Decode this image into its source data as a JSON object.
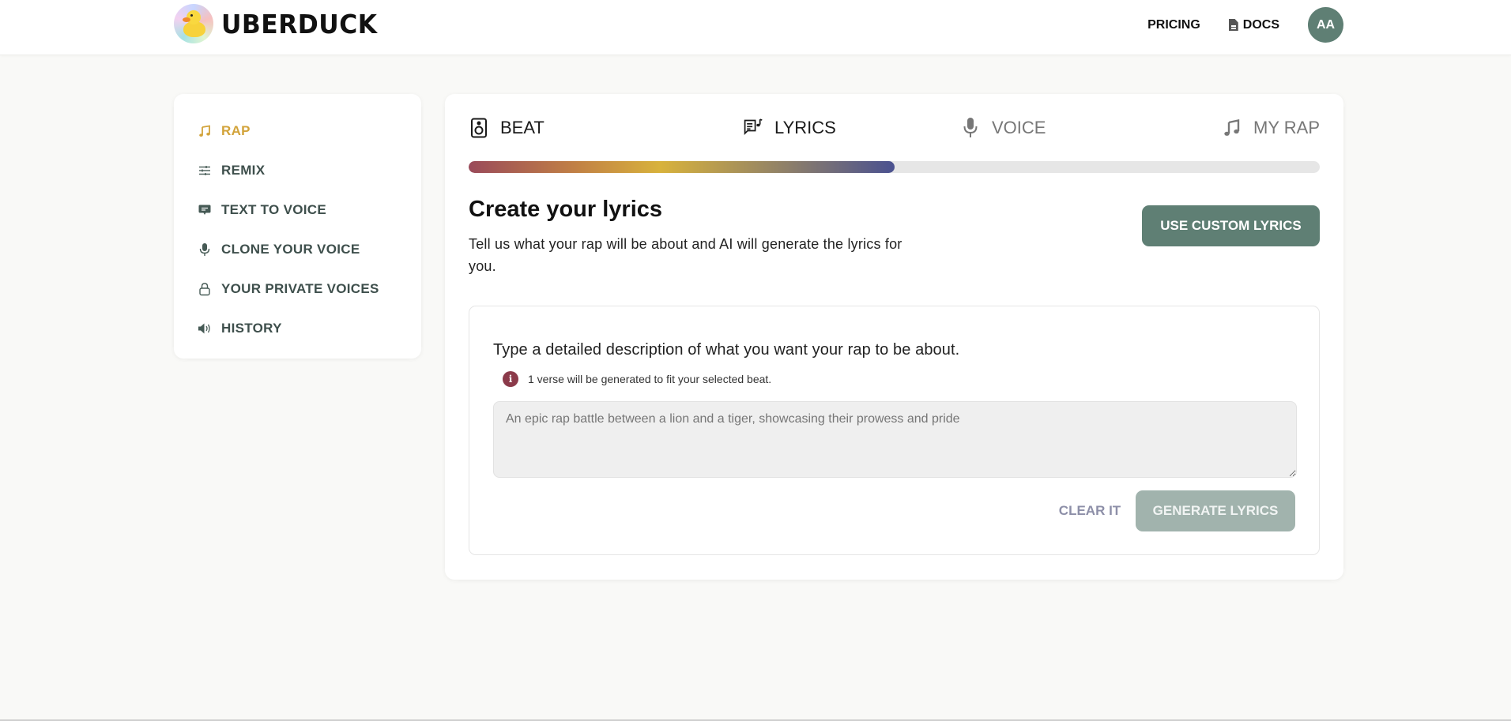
{
  "header": {
    "brand": "UBERDUCK",
    "nav": {
      "pricing": "PRICING",
      "docs": "DOCS"
    },
    "avatar_initials": "AA"
  },
  "sidebar": {
    "items": [
      {
        "label": "RAP",
        "icon": "music-note-icon",
        "active": true
      },
      {
        "label": "REMIX",
        "icon": "sliders-icon",
        "active": false
      },
      {
        "label": "TEXT TO VOICE",
        "icon": "chat-bubble-icon",
        "active": false
      },
      {
        "label": "CLONE YOUR VOICE",
        "icon": "microphone-icon",
        "active": false
      },
      {
        "label": "YOUR PRIVATE VOICES",
        "icon": "lock-icon",
        "active": false
      },
      {
        "label": "HISTORY",
        "icon": "speaker-icon",
        "active": false
      }
    ]
  },
  "steps": [
    {
      "label": "BEAT",
      "icon": "speaker-box-icon",
      "state": "done"
    },
    {
      "label": "LYRICS",
      "icon": "lyrics-icon",
      "state": "current"
    },
    {
      "label": "VOICE",
      "icon": "microphone-icon",
      "state": "upcoming"
    },
    {
      "label": "MY RAP",
      "icon": "music-note-icon",
      "state": "upcoming"
    }
  ],
  "progress": {
    "percent": 50
  },
  "main": {
    "title": "Create your lyrics",
    "subtitle": "Tell us what your rap will be about and AI will generate the lyrics for you.",
    "custom_lyrics_button": "USE CUSTOM LYRICS",
    "prompt_label": "Type a detailed description of what you want your rap to be about.",
    "info_text": "1 verse will be generated to fit your selected beat.",
    "textarea": {
      "value": "",
      "placeholder": "An epic rap battle between a lion and a tiger, showcasing their prowess and pride"
    },
    "clear_button": "CLEAR IT",
    "generate_button": "GENERATE LYRICS"
  },
  "colors": {
    "accent_gold": "#d2a33a",
    "primary_green": "#5f7f74",
    "disabled_green": "#a1b3ad",
    "info_red": "#8b3a4a"
  }
}
